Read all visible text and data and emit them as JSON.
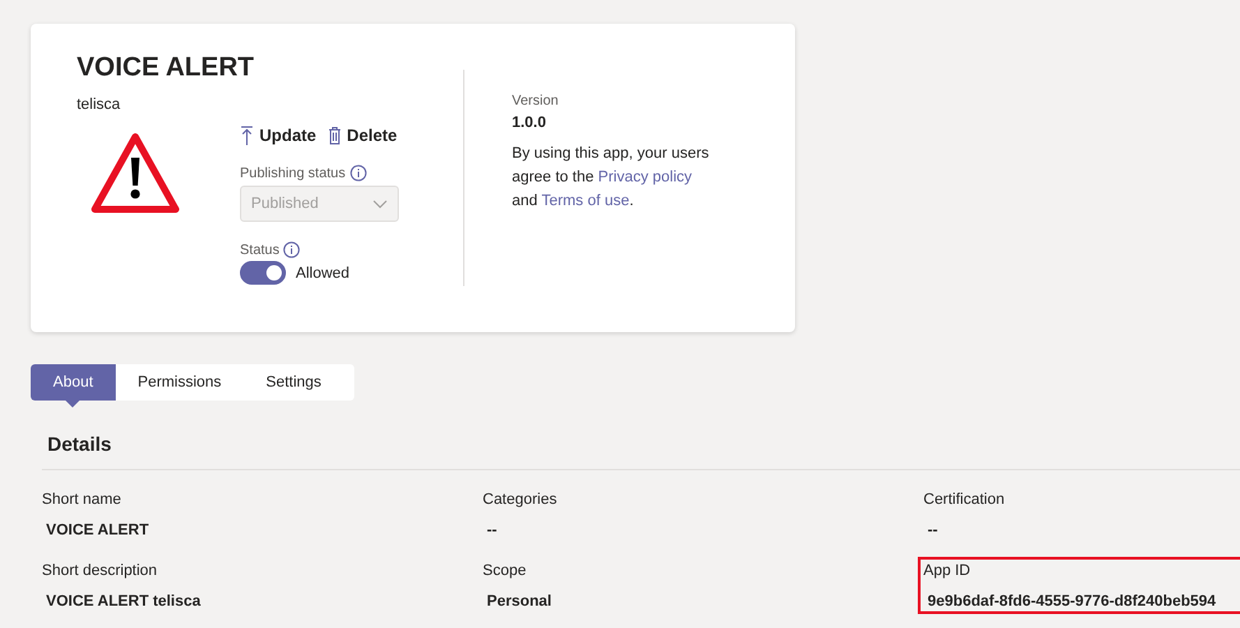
{
  "app": {
    "title": "VOICE ALERT",
    "publisher": "telisca",
    "actions": [
      {
        "kind": "update",
        "label": "Update"
      },
      {
        "kind": "delete",
        "label": "Delete"
      }
    ],
    "publishing_status": {
      "label": "Publishing status",
      "value": "Published",
      "disabled": true
    },
    "status": {
      "label": "Status",
      "on": true,
      "value": "Allowed"
    },
    "version": {
      "label": "Version",
      "value": "1.0.0"
    },
    "agreement": [
      {
        "kind": "text",
        "text": "By using this app, your users agree to the "
      },
      {
        "kind": "link",
        "text": "Privacy policy"
      },
      {
        "kind": "text",
        "text": " and "
      },
      {
        "kind": "link",
        "text": "Terms of use"
      },
      {
        "kind": "text",
        "text": "."
      }
    ]
  },
  "tabs": [
    {
      "label": "About",
      "selected": true
    },
    {
      "label": "Permissions",
      "selected": false
    },
    {
      "label": "Settings",
      "selected": false
    }
  ],
  "details": {
    "title": "Details",
    "fields": [
      {
        "label": "Short name",
        "value": "VOICE ALERT",
        "highlighted": false
      },
      {
        "label": "Categories",
        "value": "--",
        "highlighted": false
      },
      {
        "label": "Certification",
        "value": "--",
        "highlighted": false
      },
      {
        "label": "Short description",
        "value": "VOICE ALERT telisca",
        "highlighted": false
      },
      {
        "label": "Scope",
        "value": "Personal",
        "highlighted": false
      },
      {
        "label": "App ID",
        "value": "9e9b6daf-8fd6-4555-9776-d8f240beb594",
        "highlighted": true
      }
    ]
  }
}
